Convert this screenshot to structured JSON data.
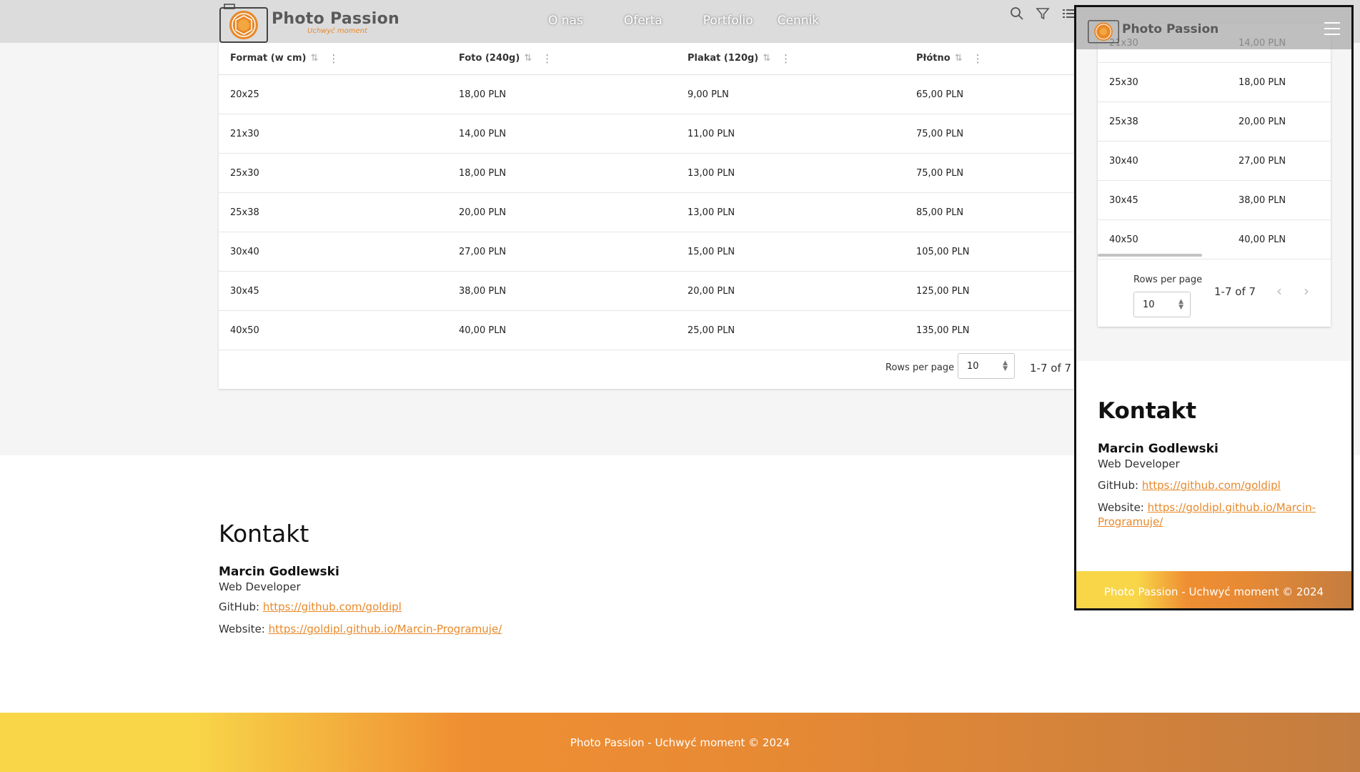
{
  "brand": {
    "title": "Photo Passion",
    "tagline": "Uchwyć moment",
    "accent": "#e8892a"
  },
  "nav": {
    "items": [
      "O nas",
      "Oferta",
      "Portfolio",
      "Cennik"
    ]
  },
  "tools": {
    "search_icon": "search-icon",
    "filter_icon": "filter-icon",
    "columns_icon": "columns-icon"
  },
  "table": {
    "columns": [
      "Format (w cm)",
      "Foto (240g)",
      "Plakat (120g)",
      "Płótno"
    ],
    "rows": [
      [
        "20x25",
        "18,00 PLN",
        "9,00 PLN",
        "65,00 PLN"
      ],
      [
        "21x30",
        "14,00 PLN",
        "11,00 PLN",
        "75,00 PLN"
      ],
      [
        "25x30",
        "18,00 PLN",
        "13,00 PLN",
        "75,00 PLN"
      ],
      [
        "25x38",
        "20,00 PLN",
        "13,00 PLN",
        "85,00 PLN"
      ],
      [
        "30x40",
        "27,00 PLN",
        "15,00 PLN",
        "105,00 PLN"
      ],
      [
        "30x45",
        "38,00 PLN",
        "20,00 PLN",
        "125,00 PLN"
      ],
      [
        "40x50",
        "40,00 PLN",
        "25,00 PLN",
        "135,00 PLN"
      ]
    ],
    "rows_per_page_label": "Rows per page",
    "rows_per_page_value": "10",
    "page_info": "1-7 of 7"
  },
  "contact": {
    "title": "Kontakt",
    "name": "Marcin Godlewski",
    "role": "Web Developer",
    "github_label": "GitHub:",
    "github_url": "https://github.com/goldipl",
    "website_label": "Website:",
    "website_url": "https://goldipl.github.io/Marcin-Programuje/",
    "website_url_part1": "https://goldipl.github.io/Marcin-",
    "website_url_part2": "Programuje/"
  },
  "footer": {
    "text": "Photo Passion - Uchwyć moment © 2024"
  },
  "mobile": {
    "rows": [
      [
        "21x30",
        "14,00 PLN"
      ],
      [
        "25x30",
        "18,00 PLN"
      ],
      [
        "25x38",
        "20,00 PLN"
      ],
      [
        "30x40",
        "27,00 PLN"
      ],
      [
        "30x45",
        "38,00 PLN"
      ],
      [
        "40x50",
        "40,00 PLN"
      ]
    ],
    "prev_icon": "chevron-left-icon",
    "next_icon": "chevron-right-icon",
    "menu_icon": "hamburger-menu-icon"
  }
}
